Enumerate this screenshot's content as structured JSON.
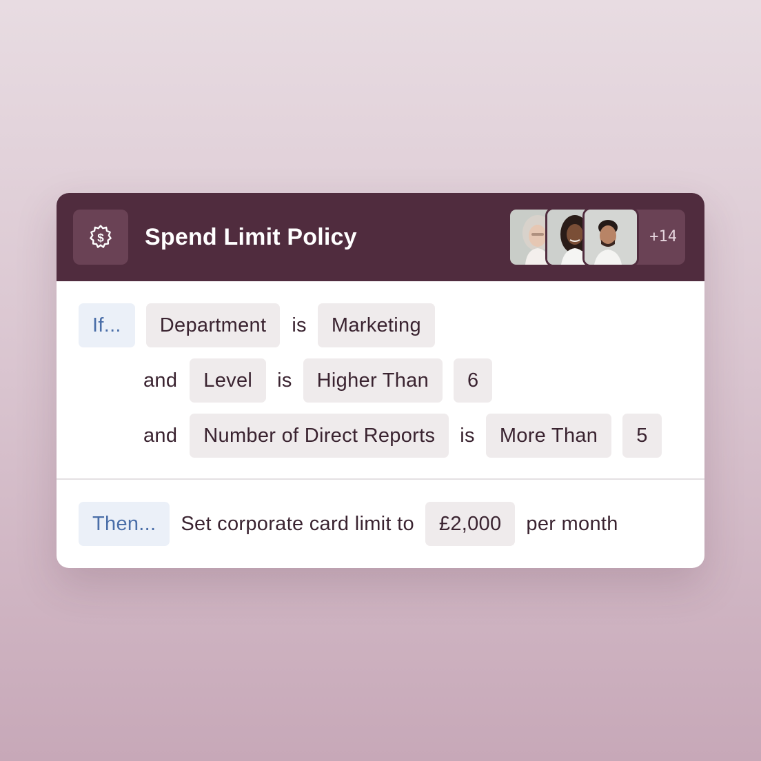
{
  "policy": {
    "title": "Spend Limit Policy",
    "icon": "gear-dollar-icon",
    "members_more": "+14"
  },
  "conditions": {
    "if_label": "If...",
    "rows": [
      {
        "connector": "",
        "field": "Department",
        "operator_word": "is",
        "comparator": "",
        "value": "Marketing"
      },
      {
        "connector": "and",
        "field": "Level",
        "operator_word": "is",
        "comparator": "Higher Than",
        "value": "6"
      },
      {
        "connector": "and",
        "field": "Number of Direct Reports",
        "operator_word": "is",
        "comparator": "More Than",
        "value": "5"
      }
    ]
  },
  "action": {
    "then_label": "Then...",
    "text": "Set corporate card limit to",
    "amount": "£2,000",
    "period": "per month"
  },
  "colors": {
    "header_bg": "#502c3e",
    "chip_bg": "#efebec",
    "keyword_chip_bg": "#ebf0f8",
    "keyword_text": "#4a6ea8"
  }
}
